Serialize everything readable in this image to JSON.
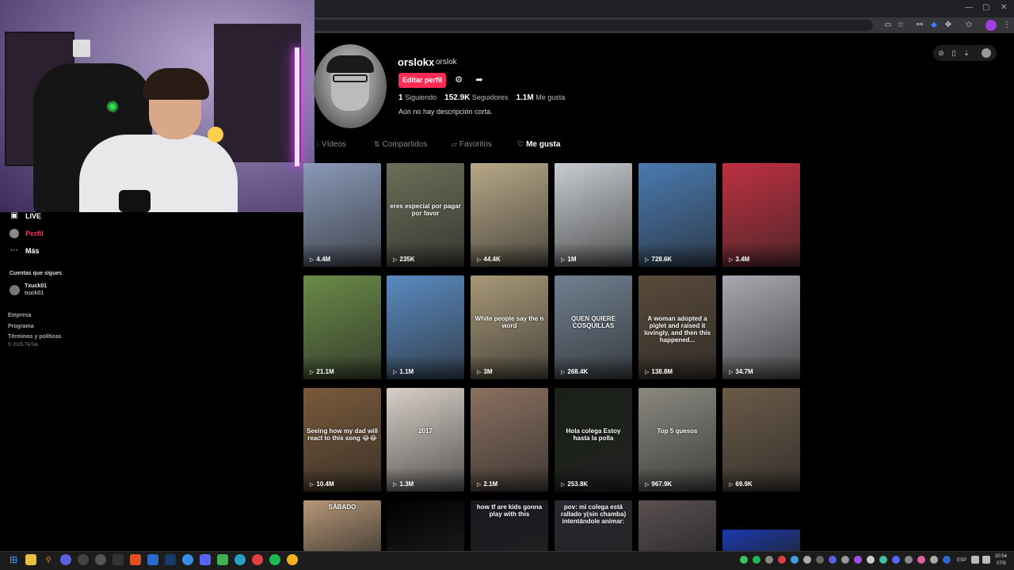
{
  "browser": {
    "window_controls": [
      "—",
      "▢",
      "✕"
    ]
  },
  "profile": {
    "username": "orslokx",
    "nickname": "orslok",
    "edit_button": "Editar perfil",
    "following_count": "1",
    "following_label": "Siguiendo",
    "followers_count": "152.9K",
    "followers_label": "Seguidores",
    "likes_count": "1.1M",
    "likes_label": "Me gusta",
    "bio": "Aún no hay descripción corta."
  },
  "tabs": [
    {
      "label": "Vídeos",
      "icon": "grid-icon",
      "glyph": "⦙⦙"
    },
    {
      "label": "Compartidos",
      "icon": "repost-icon",
      "glyph": "⇅"
    },
    {
      "label": "Favoritos",
      "icon": "bookmark-icon",
      "glyph": "▱"
    },
    {
      "label": "Me gusta",
      "icon": "heart-icon",
      "glyph": "♡"
    }
  ],
  "sidebar": {
    "live": "LIVE",
    "profile": "Perfil",
    "more": "Más",
    "following_section": "Cuentas que sigues",
    "followed_account_name": "Txuck01",
    "followed_account_handle": "txuck01",
    "footer": [
      "Empresa",
      "Programa",
      "Términos y políticas"
    ],
    "copyright": "© 2025 TikTok"
  },
  "videos": [
    {
      "views": "4.4M",
      "bg": "#8a9ab8",
      "caption": ""
    },
    {
      "views": "235K",
      "bg": "#6a7058",
      "caption": "eres especial por pagar por favor"
    },
    {
      "views": "44.4K",
      "bg": "#b8a888",
      "caption": ""
    },
    {
      "views": "1M",
      "bg": "#c8ccd0",
      "caption": ""
    },
    {
      "views": "728.6K",
      "bg": "#4a7ab0",
      "caption": ""
    },
    {
      "views": "3.4M",
      "bg": "#c03040",
      "caption": ""
    },
    {
      "views": "21.1M",
      "bg": "#6a8a48",
      "caption": ""
    },
    {
      "views": "1.1M",
      "bg": "#5a8ac0",
      "caption": ""
    },
    {
      "views": "3M",
      "bg": "#a89878",
      "caption": "White people say the n word"
    },
    {
      "views": "268.4K",
      "bg": "#708090",
      "caption": "QUEN QUIERE COSQUILLAS"
    },
    {
      "views": "138.8M",
      "bg": "#5a4a3a",
      "caption": "A woman adopted a piglet and raised it lovingly, and then this happened..."
    },
    {
      "views": "34.7M",
      "bg": "#a8a8b0",
      "caption": ""
    },
    {
      "views": "10.4M",
      "bg": "#7a5a3a",
      "caption": "Seeing how my dad will react to this song 😂😂"
    },
    {
      "views": "1.3M",
      "bg": "#d8d0c8",
      "caption": "2017"
    },
    {
      "views": "2.1M",
      "bg": "#8a7060",
      "caption": ""
    },
    {
      "views": "253.8K",
      "bg": "#1a2018",
      "caption": "Hola colega Estoy hasta la polla"
    },
    {
      "views": "967.9K",
      "bg": "#8a8880",
      "caption": "Top 5 quesos"
    },
    {
      "views": "69.9K",
      "bg": "#6a5a48",
      "caption": ""
    },
    {
      "views": "",
      "bg": "#b89878",
      "caption": "SÁBADO"
    },
    {
      "views": "",
      "bg": "#000000",
      "caption": ""
    },
    {
      "views": "",
      "bg": "#181820",
      "caption": "how tf are kids gonna play with this"
    },
    {
      "views": "",
      "bg": "#2a2830",
      "caption": "pov: mi colega está rallado y(sin chamba) intentándole animar:"
    },
    {
      "views": "",
      "bg": "#5a5050",
      "caption": ""
    },
    {
      "views": "",
      "bg": "#1a3ab0",
      "caption": ""
    }
  ],
  "taskbar": {
    "language": "ESP",
    "time": "20:54",
    "date": "07/9"
  },
  "colors": {
    "accent": "#fe2c55",
    "background": "#000000"
  }
}
